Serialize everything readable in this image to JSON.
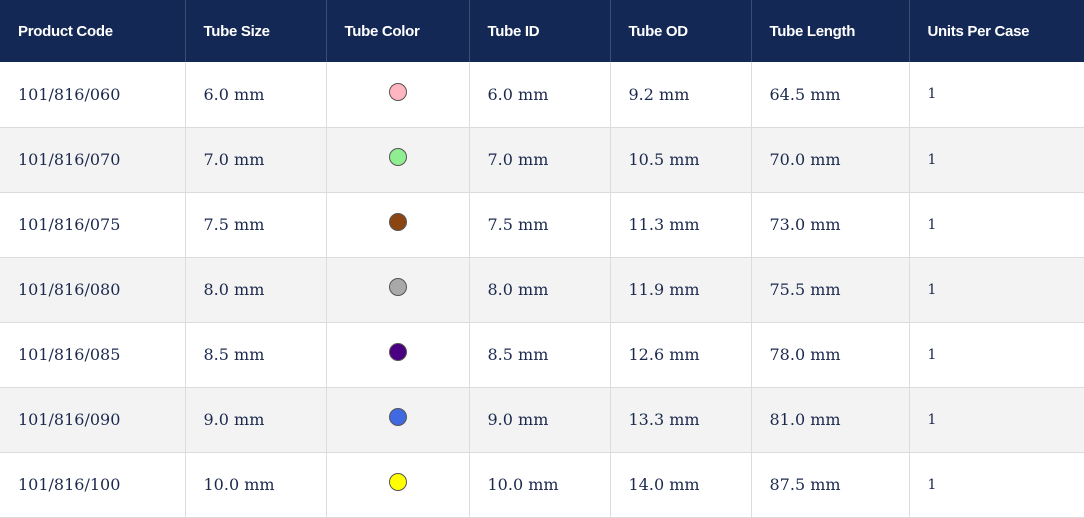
{
  "table": {
    "headers": [
      "Product Code",
      "Tube Size",
      "Tube Color",
      "Tube ID",
      "Tube OD",
      "Tube Length",
      "Units Per Case"
    ],
    "rows": [
      {
        "product_code": "101/816/060",
        "tube_size": "6.0 mm",
        "tube_color": "pink",
        "tube_color_hex": "#ffb6c1",
        "tube_id": "6.0 mm",
        "tube_od": "9.2 mm",
        "tube_length": "64.5 mm",
        "units_per_case": "1"
      },
      {
        "product_code": "101/816/070",
        "tube_size": "7.0 mm",
        "tube_color": "light green",
        "tube_color_hex": "#90ee90",
        "tube_id": "7.0 mm",
        "tube_od": "10.5 mm",
        "tube_length": "70.0 mm",
        "units_per_case": "1"
      },
      {
        "product_code": "101/816/075",
        "tube_size": "7.5 mm",
        "tube_color": "brown",
        "tube_color_hex": "#8b4513",
        "tube_id": "7.5 mm",
        "tube_od": "11.3 mm",
        "tube_length": "73.0 mm",
        "units_per_case": "1"
      },
      {
        "product_code": "101/816/080",
        "tube_size": "8.0 mm",
        "tube_color": "gray",
        "tube_color_hex": "#a9a9a9",
        "tube_id": "8.0 mm",
        "tube_od": "11.9 mm",
        "tube_length": "75.5 mm",
        "units_per_case": "1"
      },
      {
        "product_code": "101/816/085",
        "tube_size": "8.5 mm",
        "tube_color": "purple",
        "tube_color_hex": "#4b0082",
        "tube_id": "8.5 mm",
        "tube_od": "12.6 mm",
        "tube_length": "78.0 mm",
        "units_per_case": "1"
      },
      {
        "product_code": "101/816/090",
        "tube_size": "9.0 mm",
        "tube_color": "blue",
        "tube_color_hex": "#4169e1",
        "tube_id": "9.0 mm",
        "tube_od": "13.3 mm",
        "tube_length": "81.0 mm",
        "units_per_case": "1"
      },
      {
        "product_code": "101/816/100",
        "tube_size": "10.0 mm",
        "tube_color": "yellow",
        "tube_color_hex": "#ffff00",
        "tube_id": "10.0 mm",
        "tube_od": "14.0 mm",
        "tube_length": "87.5 mm",
        "units_per_case": "1"
      }
    ]
  },
  "colors": {
    "header_bg": "#132855",
    "header_text": "#ffffff",
    "body_text": "#1c2a4e",
    "alt_row_bg": "#f3f3f3"
  }
}
